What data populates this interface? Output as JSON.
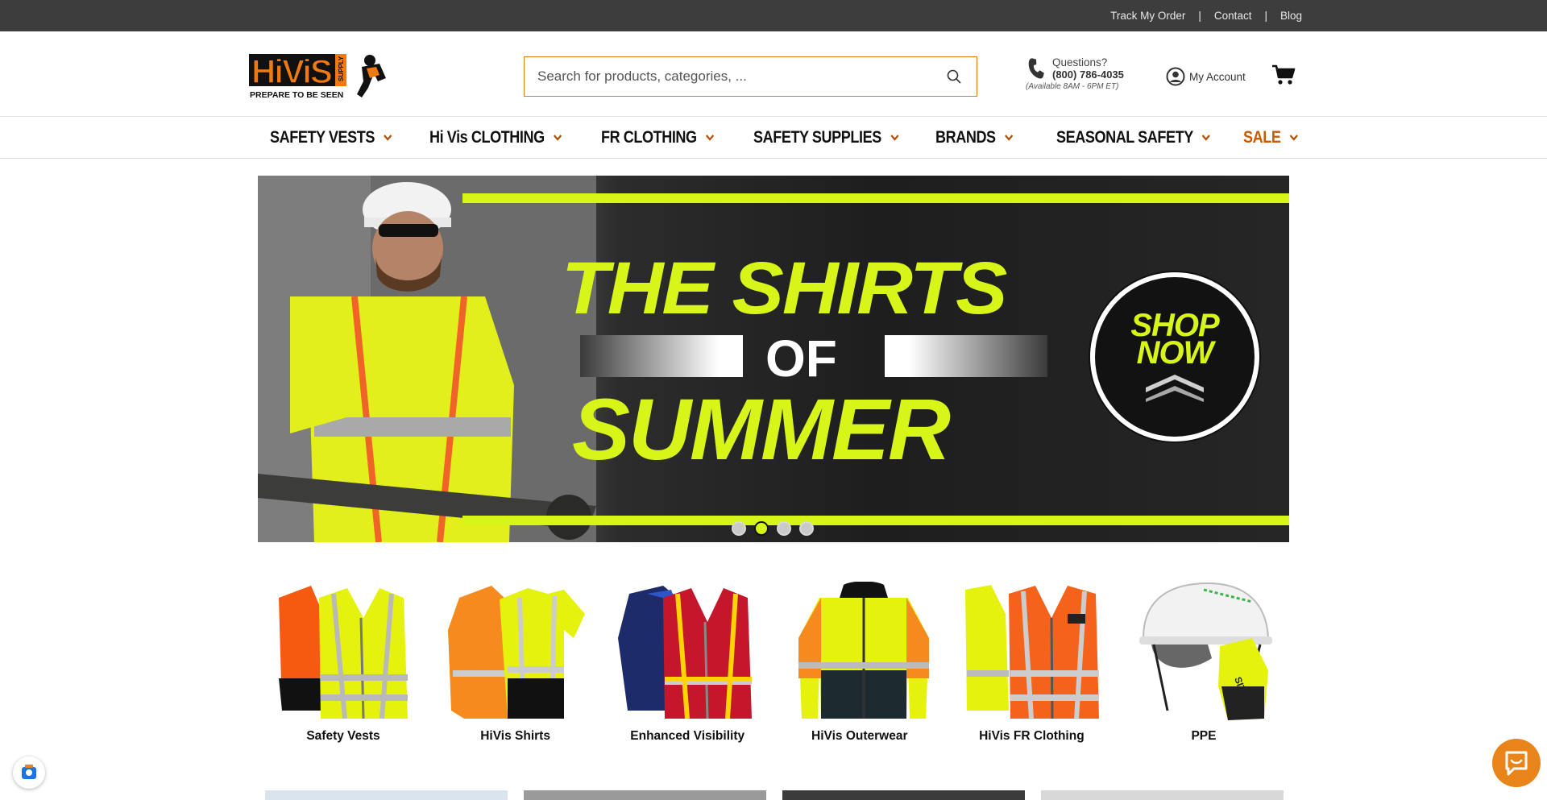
{
  "topbar": {
    "links": [
      "Track My Order",
      "Contact",
      "Blog"
    ],
    "separator": "|"
  },
  "header": {
    "logo_alt": "HiVis Supply - Prepare To Be Seen",
    "search": {
      "placeholder": "Search for products, categories, ..."
    },
    "contact": {
      "question": "Questions?",
      "phone": "(800) 786-4035",
      "availability": "(Available 8AM - 6PM ET)"
    },
    "account_label": "My Account"
  },
  "nav": {
    "items": [
      {
        "label": "SAFETY VESTS"
      },
      {
        "label": "Hi Vis CLOTHING"
      },
      {
        "label": "FR CLOTHING"
      },
      {
        "label": "SAFETY SUPPLIES"
      },
      {
        "label": "BRANDS"
      },
      {
        "label": "SEASONAL SAFETY"
      },
      {
        "label": "SALE"
      }
    ]
  },
  "banner": {
    "line1": "THE SHIRTS",
    "line2": "OF",
    "line3": "SUMMER",
    "cta": "SHOP NOW",
    "accent_color": "#d8f51a",
    "slides": 4,
    "active_slide": 2
  },
  "categories": [
    {
      "label": "Safety Vests"
    },
    {
      "label": "HiVis Shirts"
    },
    {
      "label": "Enhanced Visibility"
    },
    {
      "label": "HiVis Outerwear"
    },
    {
      "label": "HiVis FR Clothing"
    },
    {
      "label": "PPE"
    }
  ],
  "colors": {
    "topbar_bg": "#3d3d3d",
    "search_border": "#e07b10",
    "sale": "#c85a00",
    "chat": "#e8841a"
  }
}
